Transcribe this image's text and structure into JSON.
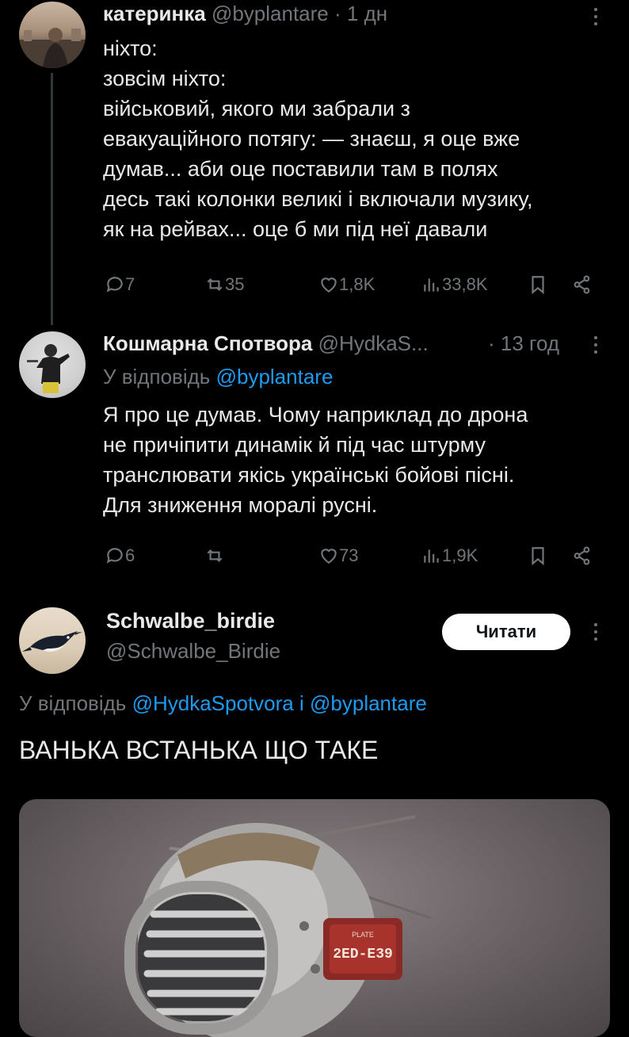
{
  "tweet1": {
    "name": "катеринка",
    "handle": "@byplantare",
    "time": "· 1 дн",
    "text": "ніхто:\nзовсім ніхто:\nвійськовий, якого ми забрали з\nевакуаційного потягу: — знаєш, я оце вже\nдумав... аби оце поставили там в полях\nдесь такі колонки великі і включали музику,\nяк на рейвах... оце б ми під неї давали",
    "replies": "7",
    "retweets": "35",
    "likes": "1,8K",
    "views": "33,8K"
  },
  "tweet2": {
    "name": "Кошмарна Спотвора",
    "handle": "@HydkaS...",
    "time": "· 13 год",
    "reply_prefix": "У відповідь",
    "reply_to": "@byplantare",
    "text": "Я про це думав. Чому наприклад до дрона\nне причіпити динамік й під час штурму\nтранслювати якісь українські бойові пісні.\nДля зниження моралі русні.",
    "replies": "6",
    "retweets": "",
    "likes": "73",
    "views": "1,9K"
  },
  "tweet3": {
    "name": "Schwalbe_birdie",
    "handle": "@Schwalbe_Birdie",
    "follow_label": "Читати",
    "reply_prefix": "У відповідь",
    "reply_to_1": "@HydkaSpotvora",
    "reply_join": "і",
    "reply_to_2": "@byplantare",
    "text": "ВАНЬКА ВСТАНЬКА ЩО ТАКЕ",
    "plate_text_top": "PLATE",
    "plate_text_main": "2ED-E39"
  },
  "colors": {
    "background": "#000000",
    "text": "#e7e9ea",
    "muted": "#71767b",
    "link": "#1d9bf0",
    "button_bg": "#ffffff"
  },
  "icons": [
    "reply-icon",
    "retweet-icon",
    "like-icon",
    "views-icon",
    "bookmark-icon",
    "share-icon",
    "more-icon"
  ]
}
